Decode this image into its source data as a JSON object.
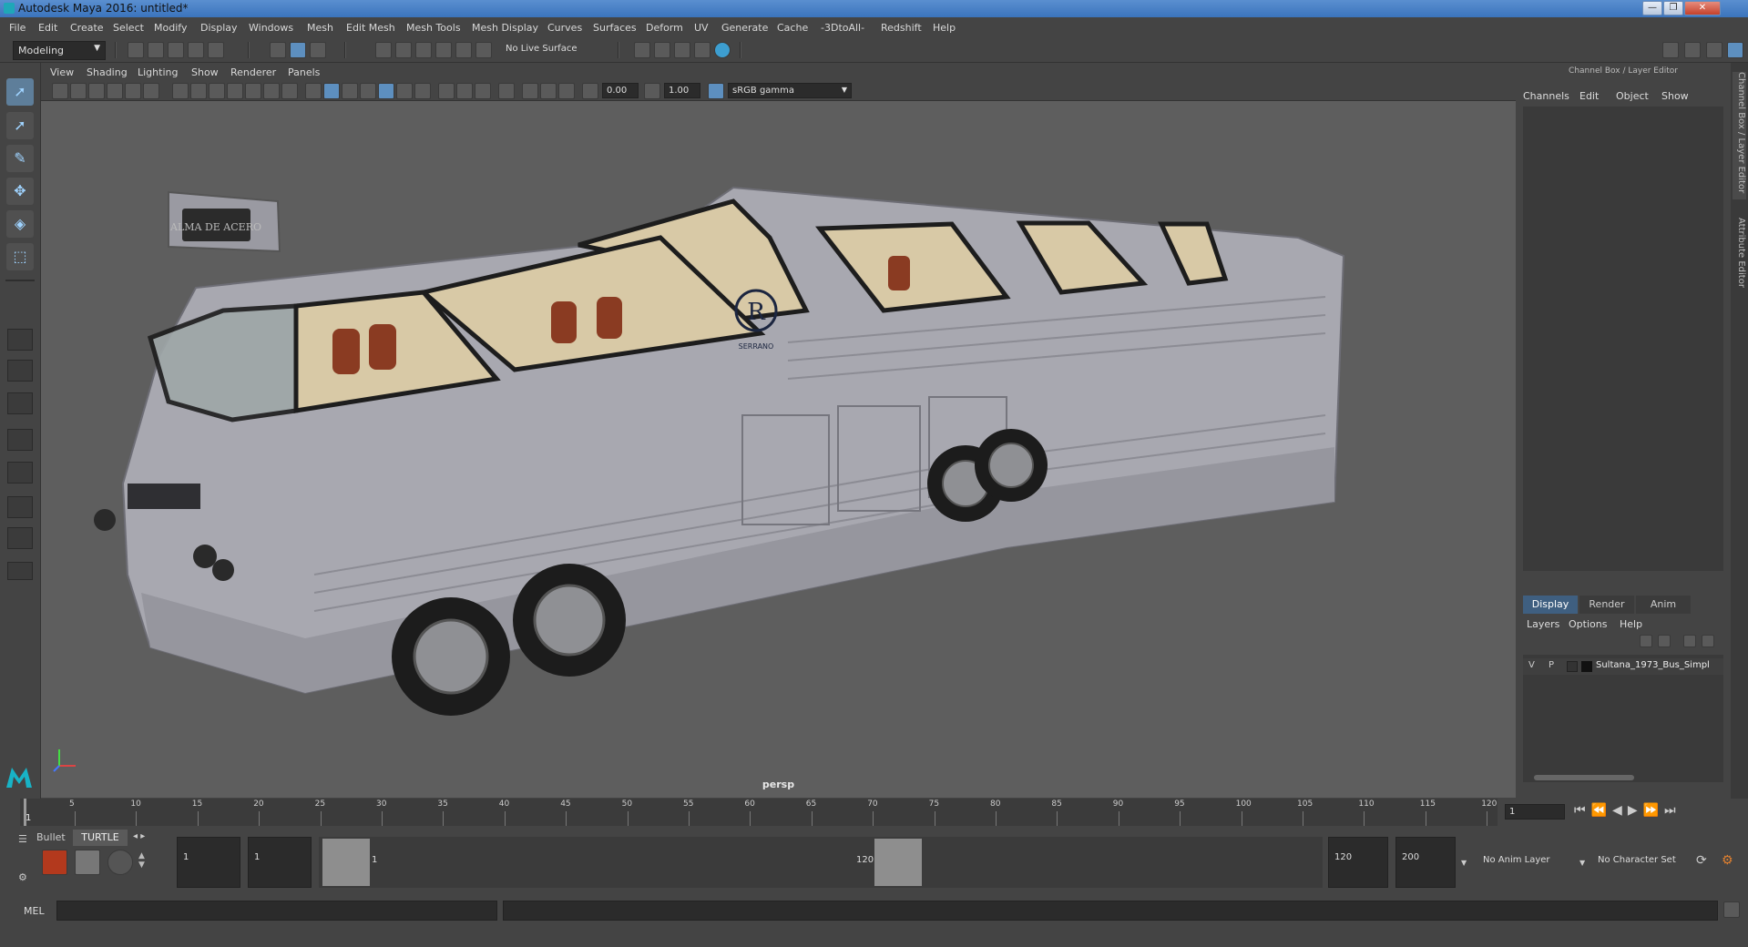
{
  "window": {
    "title": "Autodesk Maya 2016: untitled*",
    "min": "—",
    "max": "❐",
    "close": "✕"
  },
  "menubar": [
    "File",
    "Edit",
    "Create",
    "Select",
    "Modify",
    "Display",
    "Windows",
    "Mesh",
    "Edit Mesh",
    "Mesh Tools",
    "Mesh Display",
    "Curves",
    "Surfaces",
    "Deform",
    "UV",
    "Generate",
    "Cache",
    "-3DtoAll-",
    "Redshift",
    "Help"
  ],
  "statusline": {
    "mode": "Modeling",
    "live_surface": "No Live Surface"
  },
  "panel_menu": [
    "View",
    "Shading",
    "Lighting",
    "Show",
    "Renderer",
    "Panels"
  ],
  "panel_toolbar": {
    "exposure": "0.00",
    "gamma": "1.00",
    "colorspace": "sRGB gamma"
  },
  "viewport": {
    "camera": "persp",
    "bus_sign": "ALMA DE ACERO",
    "logo_letter": "R",
    "logo_text": "SERRANO"
  },
  "channel_box": {
    "header": "Channel Box / Layer Editor",
    "menu": [
      "Channels",
      "Edit",
      "Object",
      "Show"
    ],
    "tabs": [
      "Display",
      "Render",
      "Anim"
    ],
    "layer_menu": [
      "Layers",
      "Options",
      "Help"
    ],
    "layer": {
      "v": "V",
      "p": "P",
      "name": "Sultana_1973_Bus_Simpl"
    }
  },
  "side_tabs": [
    "Channel Box / Layer Editor",
    "Attribute Editor"
  ],
  "time_slider": {
    "ticks": [
      "5",
      "10",
      "15",
      "20",
      "25",
      "30",
      "35",
      "40",
      "45",
      "50",
      "55",
      "60",
      "65",
      "70",
      "75",
      "80",
      "85",
      "90",
      "95",
      "100",
      "105",
      "110",
      "115",
      "120"
    ],
    "current_frame_label": "1",
    "current_frame_field": "1"
  },
  "range_slider": {
    "shelf_tabs": [
      "Bullet",
      "TURTLE"
    ],
    "start_time": "1",
    "playback_start": "1",
    "range_start_label": "1",
    "range_end_label": "120",
    "playback_end": "120",
    "end_time": "200",
    "anim_layer": "No Anim Layer",
    "character_set": "No Character Set"
  },
  "command_line": {
    "language": "MEL"
  },
  "colors": {
    "viewport_bg": "#5e5e5e",
    "accent": "#5d8fbf",
    "title_blue": "#3b74bd"
  }
}
